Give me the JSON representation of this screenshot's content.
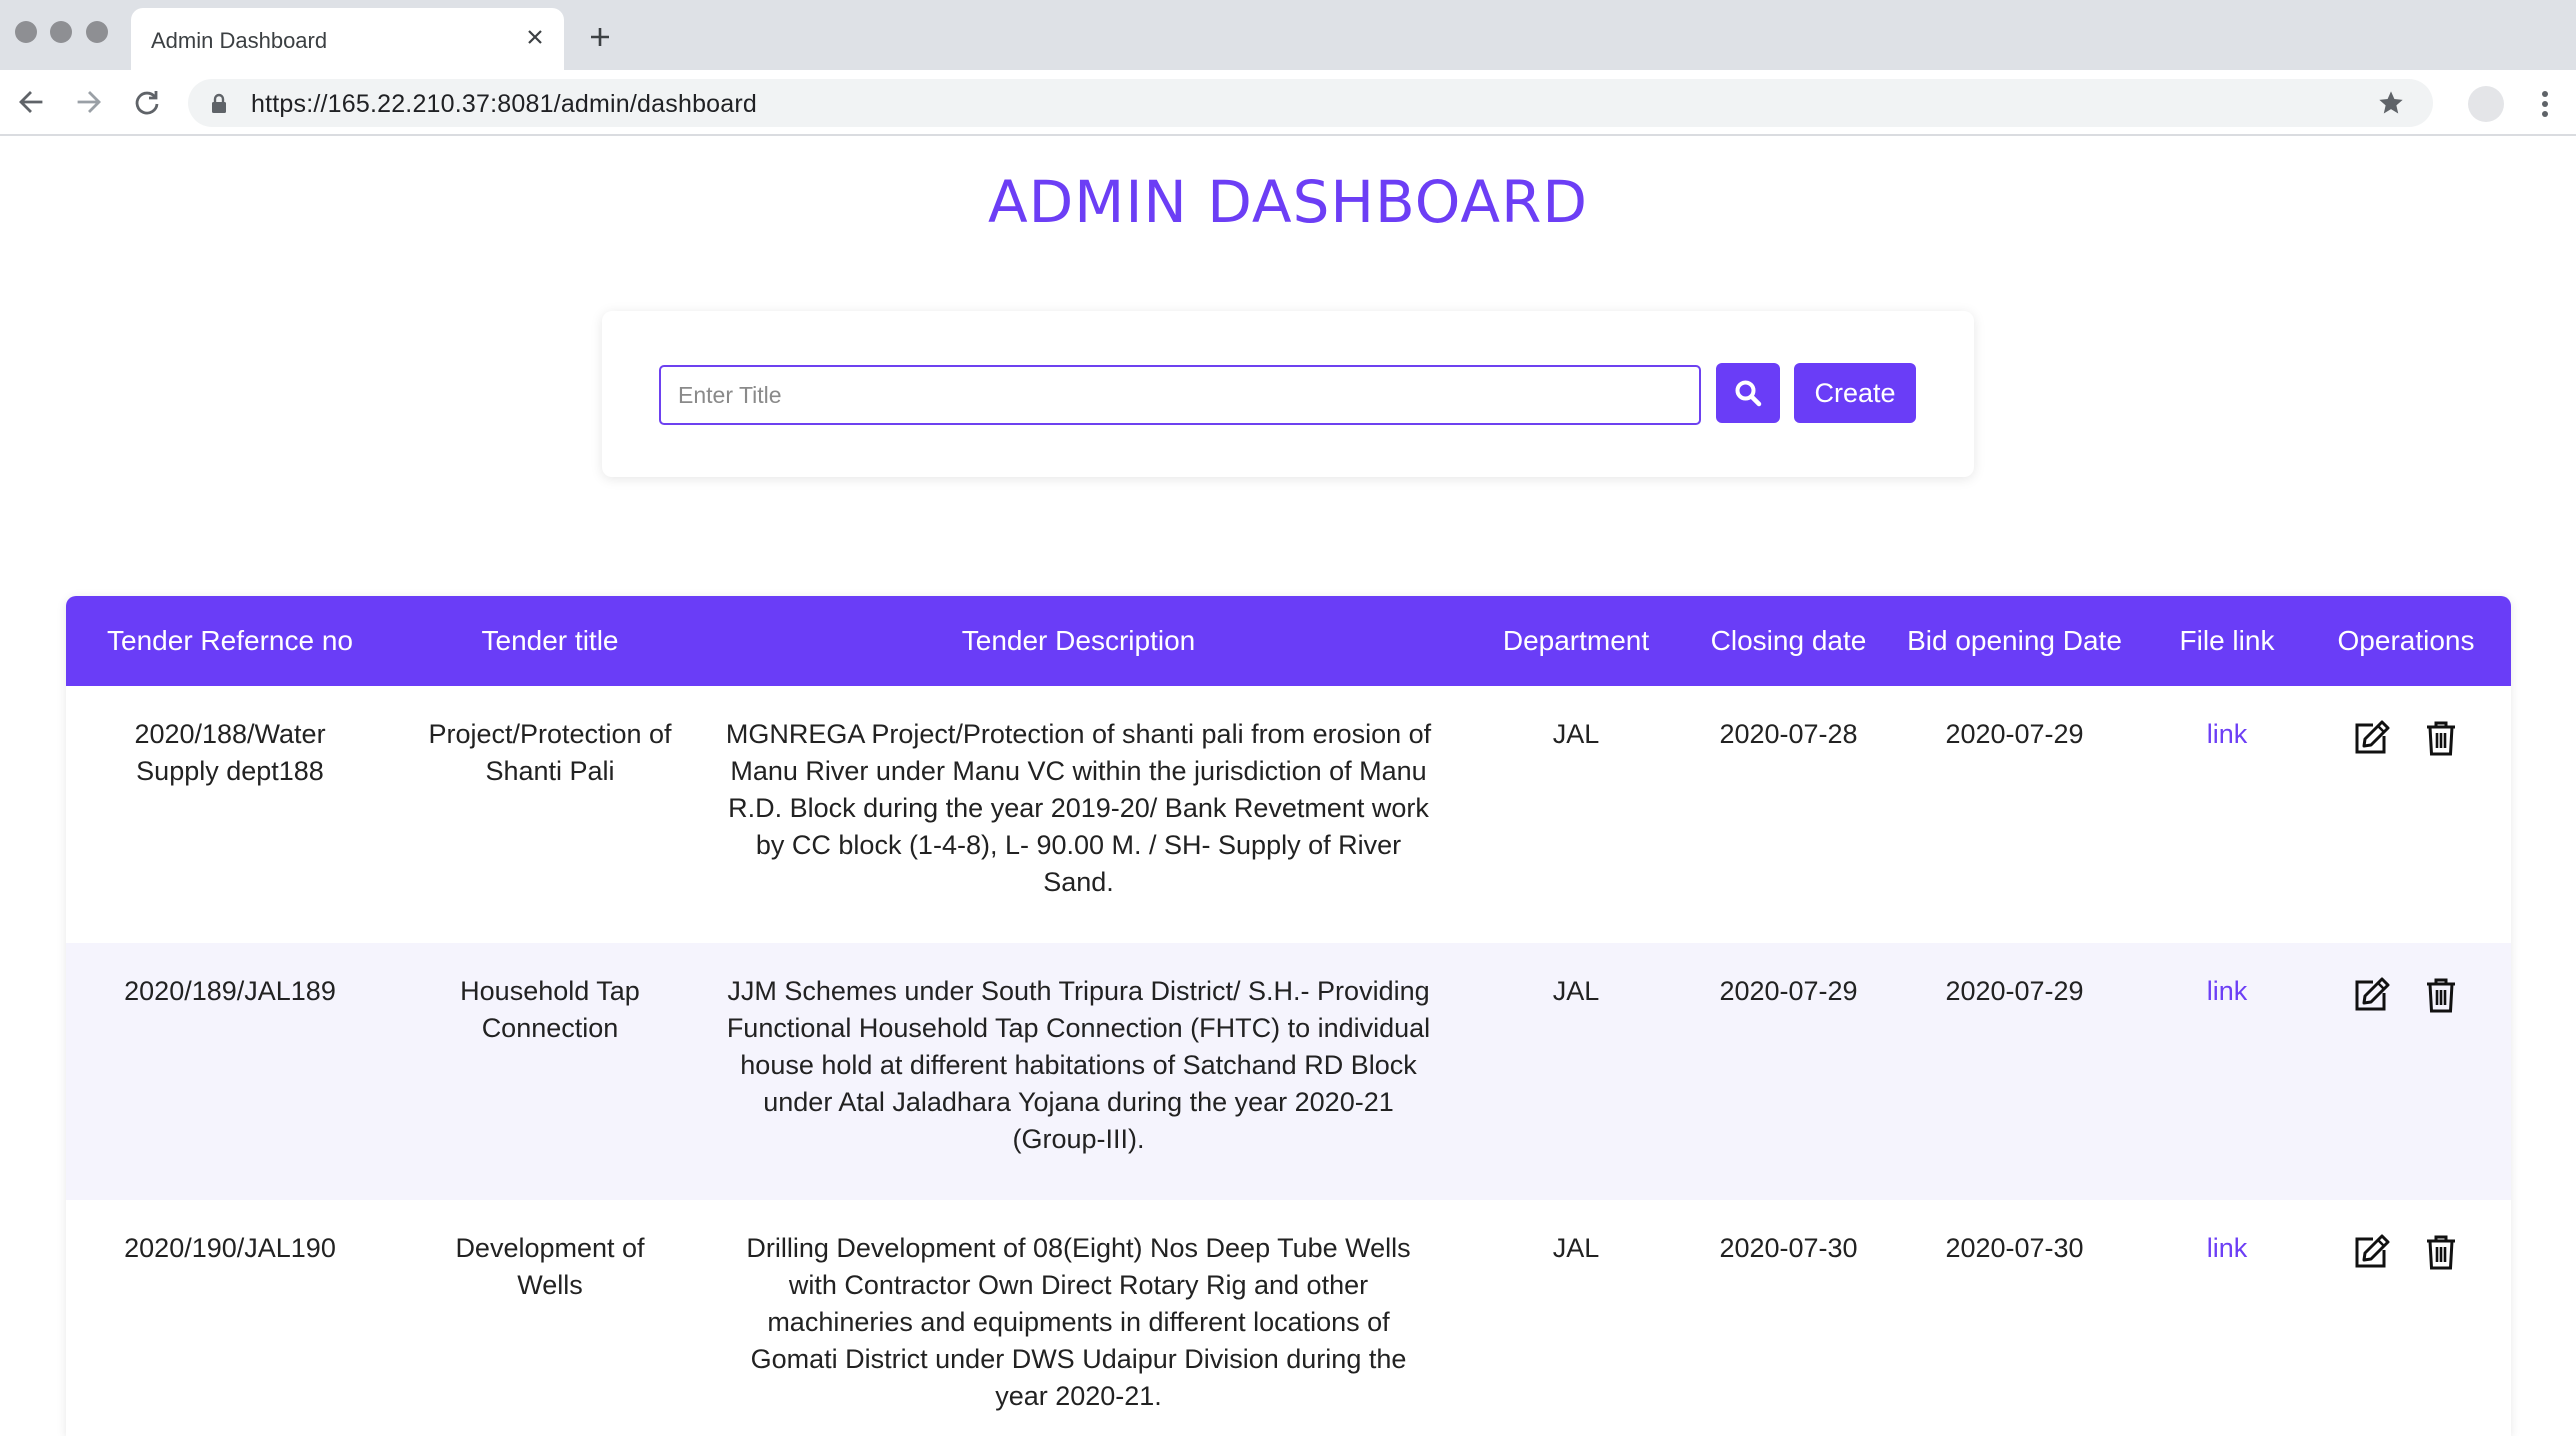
{
  "browser": {
    "tab_title": "Admin Dashboard",
    "url": "https://165.22.210.37:8081/admin/dashboard"
  },
  "page": {
    "title": "ADMIN DASHBOARD"
  },
  "search": {
    "placeholder": "Enter Title",
    "value": "",
    "create_label": "Create"
  },
  "colors": {
    "accent": "#6a3df7",
    "title": "#6c3ef5",
    "row_alt": "#f5f4fd"
  },
  "table": {
    "headers": [
      "Tender Refernce no",
      "Tender title",
      "Tender Description",
      "Department",
      "Closing date",
      "Bid opening Date",
      "File link",
      "Operations"
    ],
    "rows": [
      {
        "ref": "2020/188/Water Supply dept188",
        "title": "Project/Protection of Shanti Pali",
        "description": "MGNREGA Project/Protection of shanti pali from erosion of Manu River under Manu VC within the jurisdiction of Manu R.D. Block during the year 2019-20/ Bank Revetment work by CC block (1-4-8), L- 90.00 M. / SH- Supply of River Sand.",
        "department": "JAL",
        "closing_date": "2020-07-28",
        "bid_opening_date": "2020-07-29",
        "file_link": "link"
      },
      {
        "ref": "2020/189/JAL189",
        "title": "Household Tap Connection",
        "description": "JJM Schemes under South Tripura District/ S.H.- Providing Functional Household Tap Connection (FHTC) to individual house hold at different habitations of Satchand RD Block under Atal Jaladhara Yojana during the year 2020-21 (Group-III).",
        "department": "JAL",
        "closing_date": "2020-07-29",
        "bid_opening_date": "2020-07-29",
        "file_link": "link"
      },
      {
        "ref": "2020/190/JAL190",
        "title": "Development of Wells",
        "description": "Drilling Development of 08(Eight) Nos Deep Tube Wells with Contractor Own Direct Rotary Rig and other machineries and equipments in different locations of Gomati District under DWS Udaipur Division during the year 2020-21.",
        "department": "JAL",
        "closing_date": "2020-07-30",
        "bid_opening_date": "2020-07-30",
        "file_link": "link"
      }
    ],
    "operation_icons": [
      "edit-icon",
      "trash-icon"
    ]
  }
}
